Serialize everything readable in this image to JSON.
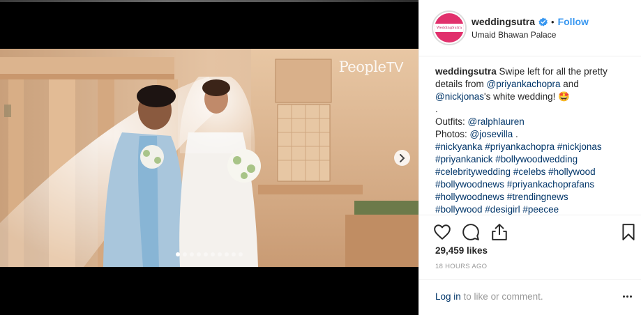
{
  "media": {
    "watermark_brand": "People",
    "watermark_suffix": "TV",
    "carousel_total": 10,
    "carousel_active": 1
  },
  "post": {
    "username": "weddingsutra",
    "separator": "•",
    "follow_label": "Follow",
    "location": "Umaid Bhawan Palace",
    "avatar_text": "WeddingSutra",
    "likes": "29,459 likes",
    "time_ago": "18 HOURS AGO"
  },
  "caption": {
    "author": "weddingsutra",
    "line1": "Swipe left for all the pretty",
    "line2_pre": "details from ",
    "mention1": "@priyankachopra",
    "line2_post": " and",
    "mention2": "@nickjonas",
    "line3_post": "'s white wedding! 🤩",
    "dot_line": ".",
    "outfits_label": "Outfits: ",
    "mention3": "@ralphlauren",
    "photos_label": "Photos: ",
    "mention4": "@josevilla",
    "photos_end": " .",
    "hashtag_lines": [
      "#nickyanka #priyankachopra #nickjonas",
      "#priyankanick #bollywoodwedding",
      "#celebritywedding #celebs #hollywood",
      "#bollywoodnews #priyankachoprafans",
      "#hollywoodnews #trendingnews",
      "#bollywood #desigirl #peecee"
    ]
  },
  "footer": {
    "login_label": "Log in",
    "login_rest": " to like or comment."
  },
  "icons": {
    "like": "heart-icon",
    "comment": "comment-icon",
    "share": "share-icon",
    "save": "bookmark-icon",
    "verified": "verified-badge-icon",
    "next": "chevron-right-icon",
    "more": "more-options-icon"
  },
  "colors": {
    "follow_blue": "#3897f0",
    "link_navy": "#003569",
    "verified_blue": "#3897f0",
    "avatar_pink": "#e1306c"
  }
}
